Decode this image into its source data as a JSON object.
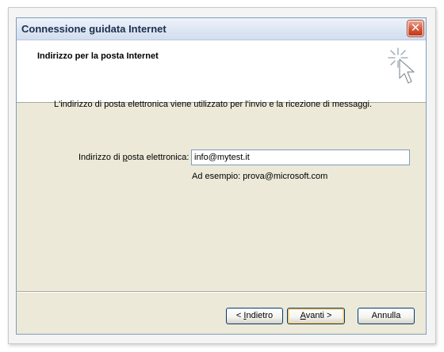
{
  "window": {
    "title": "Connessione guidata Internet",
    "close_glyph": "✕"
  },
  "header": {
    "title": "Indirizzo per la posta Internet",
    "icon": "wizard-cursor-icon"
  },
  "main": {
    "description": "L'indirizzo di posta elettronica viene utilizzato per l'invio e la ricezione di messaggi.",
    "email_label_before": "Indirizzo di ",
    "email_label_mnemonic": "p",
    "email_label_after": "osta elettronica:",
    "email_value": "info@mytest.it",
    "example": "Ad esempio: prova@microsoft.com"
  },
  "buttons": {
    "back_prefix": "< ",
    "back_mnemonic": "I",
    "back_rest": "ndietro",
    "next_mnemonic": "A",
    "next_rest": "vanti >",
    "cancel": "Annulla"
  },
  "colors": {
    "window_bg": "#ece9d8",
    "close_button": "#d3583a",
    "input_border": "#7f9db9",
    "default_button_highlight": "#f2c46d"
  }
}
